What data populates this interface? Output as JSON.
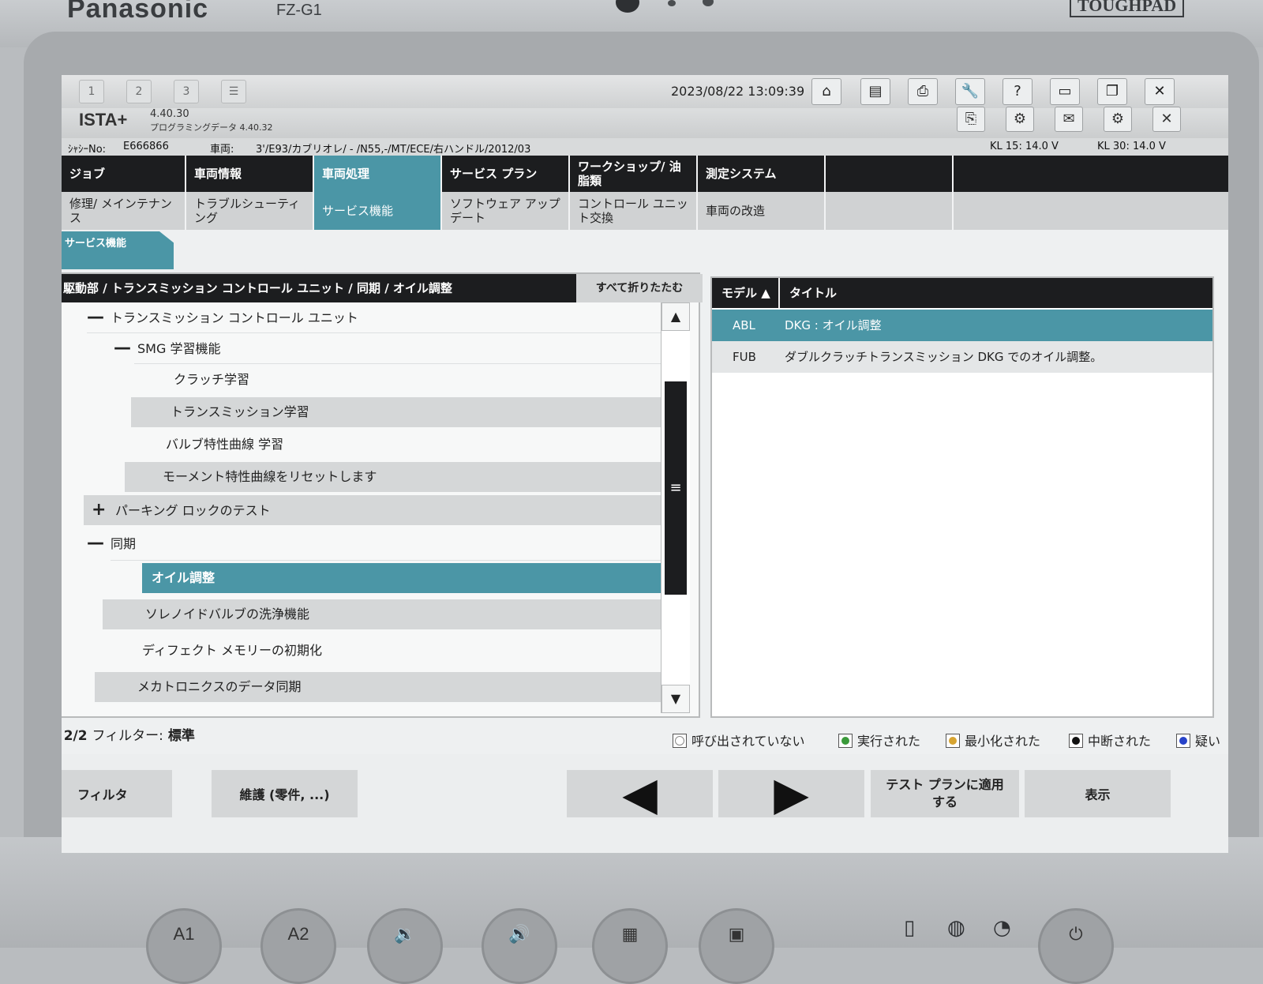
{
  "device": {
    "brand": "Panasonic",
    "model": "FZ-G1",
    "badge": "TOUGHPAD",
    "hw_buttons": [
      "A1",
      "A2"
    ]
  },
  "topbar": {
    "datetime": "2023/08/22 13:09:39",
    "tb_buttons": [
      "1",
      "2",
      "3"
    ]
  },
  "app": {
    "name": "ISTA+",
    "version": "4.40.30",
    "prog_data_label": "プログラミングデータ",
    "prog_data_version": "4.40.32"
  },
  "vehicle_info": {
    "chassis_label": "ｼｬｼｰNo:",
    "chassis_value": "E666866",
    "vehicle_label": "車両:",
    "vehicle_value": "3'/E93/カブリオレ/ - /N55,-/MT/ECE/右ハンドル/2012/03",
    "kl15": "KL 15:  14.0 V",
    "kl30": "KL 30:  14.0 V"
  },
  "nav": {
    "main": [
      "ジョブ",
      "車両情報",
      "車両処理",
      "サービス プラン",
      "ワークショップ/ 油脂類",
      "測定システム",
      "",
      ""
    ],
    "sub": [
      "修理/ メインテナンス",
      "トラブルシューティング",
      "サービス機能",
      "ソフトウェア アップデート",
      "コントロール ユニット交換",
      "車両の改造",
      "",
      ""
    ],
    "section_tab": "サービス機能",
    "active_main": "車両処理",
    "active_sub": "サービス機能"
  },
  "tree": {
    "path": "駆動部 / トランスミッション コントロール ユニット / 同期 / オイル調整",
    "collapse_all": "すべて折りたたむ",
    "items": [
      {
        "symbol": "—",
        "label": "トランスミッション コントロール ユニット"
      },
      {
        "symbol": "—",
        "label": "SMG 学習機能"
      },
      {
        "symbol": "",
        "label": "クラッチ学習"
      },
      {
        "symbol": "",
        "label": "トランスミッション学習"
      },
      {
        "symbol": "",
        "label": "バルブ特性曲線 学習"
      },
      {
        "symbol": "",
        "label": "モーメント特性曲線をリセットします"
      },
      {
        "symbol": "+",
        "label": "パーキング ロックのテスト"
      },
      {
        "symbol": "—",
        "label": "同期"
      },
      {
        "symbol": "",
        "label": "オイル調整"
      },
      {
        "symbol": "",
        "label": "ソレノイドバルブの洗浄機能"
      },
      {
        "symbol": "",
        "label": "ディフェクト メモリーの初期化"
      },
      {
        "symbol": "",
        "label": "メカトロニクスのデータ同期"
      }
    ]
  },
  "results": {
    "col_model": "モデル ▲",
    "col_title": "タイトル",
    "rows": [
      {
        "model": "ABL",
        "title": "DKG : オイル調整"
      },
      {
        "model": "FUB",
        "title": "ダブルクラッチトランスミッション DKG でのオイル調整。"
      }
    ]
  },
  "status": {
    "count": "2/2",
    "filter_label": "フィルター:",
    "filter_value": "標準"
  },
  "legend": [
    {
      "label": "呼び出されていない",
      "color": "#ffffff"
    },
    {
      "label": "実行された",
      "color": "#3a9a3a"
    },
    {
      "label": "最小化された",
      "color": "#d7a431"
    },
    {
      "label": "中断された",
      "color": "#111111"
    },
    {
      "label": "疑いの",
      "color": "#2743c9"
    }
  ],
  "buttons": {
    "filter": "フィルタ",
    "maintenance": "維護 (零件, ...)",
    "prev": "◀",
    "next": "▶",
    "apply_plan": "テスト プランに適用する",
    "display": "表示"
  }
}
